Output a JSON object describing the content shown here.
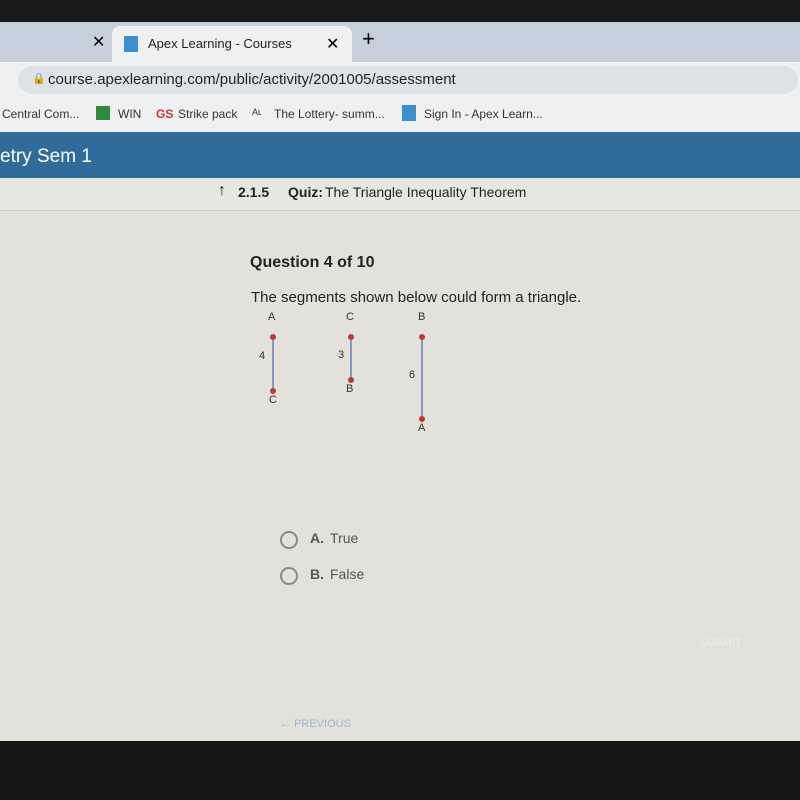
{
  "browser": {
    "tab_title": "Apex Learning - Courses",
    "url": "course.apexlearning.com/public/activity/2001005/assessment",
    "bookmarks": [
      "Central Com...",
      "WIN",
      "Strike pack",
      "The Lottery- summ...",
      "Sign In - Apex Learn..."
    ]
  },
  "course_title": "etry Sem 1",
  "quiz": {
    "number": "2.1.5",
    "label": "Quiz:",
    "title": "The Triangle Inequality Theorem"
  },
  "question": {
    "counter": "Question 4 of 10",
    "prompt": "The segments shown below could form a triangle.",
    "segments": [
      {
        "top": "A",
        "bottom": "C",
        "length": "4"
      },
      {
        "top": "C",
        "bottom": "B",
        "length": "3"
      },
      {
        "top": "B",
        "bottom": "A",
        "length": "6"
      }
    ],
    "options": [
      {
        "letter": "A.",
        "text": "True"
      },
      {
        "letter": "B.",
        "text": "False"
      }
    ]
  },
  "nav": {
    "submit": "SUBMIT",
    "previous": "PREVIOUS"
  },
  "colors": {
    "header": "#2f6c9c",
    "point": "#c0392b",
    "segment": "#6b7fc0"
  }
}
